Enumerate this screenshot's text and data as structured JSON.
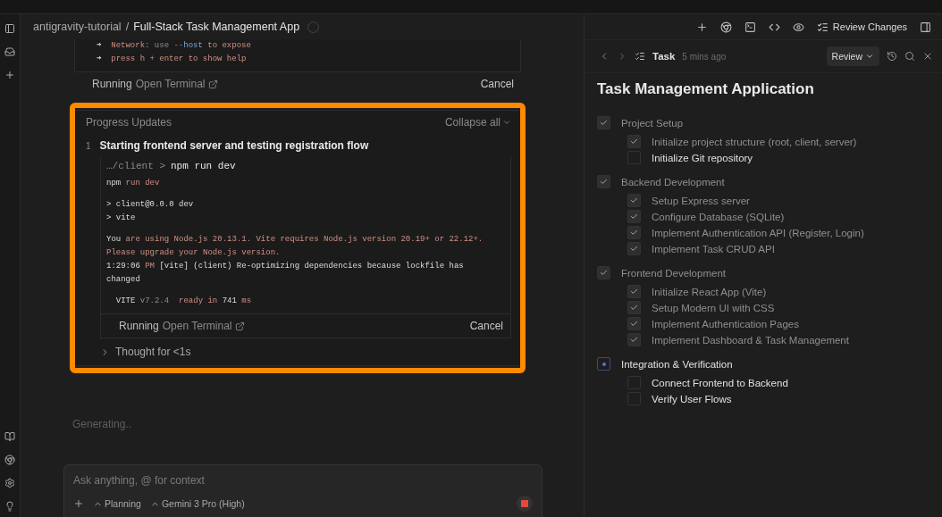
{
  "breadcrumb": {
    "workspace": "antigravity-tutorial",
    "separator": "/",
    "title": "Full-Stack Task Management App"
  },
  "toolbar": {
    "review_changes": "Review Changes"
  },
  "earlier_terminal": {
    "blocks": [
      [
        {
          "segments": [
            {
              "text": "➜  ",
              "kind": "plain"
            },
            {
              "text": "Network: ",
              "kind": "red"
            },
            {
              "text": "use --",
              "kind": "dim"
            },
            {
              "text": "host",
              "kind": "blue"
            },
            {
              "text": " to expose",
              "kind": "red"
            }
          ]
        },
        {
          "segments": [
            {
              "text": "➜  ",
              "kind": "plain"
            },
            {
              "text": "press h + enter to show help",
              "kind": "red"
            }
          ]
        }
      ]
    ],
    "status": "Running",
    "open_terminal": "Open Terminal",
    "cancel": "Cancel"
  },
  "progress": {
    "title": "Progress Updates",
    "collapse": "Collapse all",
    "step_number": "1",
    "step_title": "Starting frontend server and testing registration flow",
    "command_path": "…/client >",
    "command": "npm run dev",
    "blocks": [
      [
        {
          "segments": [
            {
              "text": "npm ",
              "kind": "plain"
            },
            {
              "text": "run dev",
              "kind": "red"
            }
          ]
        }
      ],
      [
        {
          "segments": [
            {
              "text": "> client@0.0.0 dev",
              "kind": "plain"
            }
          ]
        },
        {
          "segments": [
            {
              "text": "> vite",
              "kind": "plain"
            }
          ]
        }
      ],
      [
        {
          "segments": [
            {
              "text": "You ",
              "kind": "plain"
            },
            {
              "text": "are using Node.js 20.13.1. Vite requires Node.js version 20.19+ or 22.12+.",
              "kind": "red"
            }
          ]
        },
        {
          "segments": [
            {
              "text": "Please upgrade your Node.js version.",
              "kind": "red"
            }
          ]
        },
        {
          "segments": [
            {
              "text": "1:29:06 ",
              "kind": "plain"
            },
            {
              "text": "PM ",
              "kind": "red"
            },
            {
              "text": "[vite] (client) Re-optimizing dependencies because lockfile has",
              "kind": "plain"
            }
          ]
        },
        {
          "segments": [
            {
              "text": "changed",
              "kind": "plain"
            }
          ]
        }
      ],
      [
        {
          "segments": [
            {
              "text": "  VITE ",
              "kind": "plain"
            },
            {
              "text": "v7.2.4  ",
              "kind": "dim"
            },
            {
              "text": "ready in ",
              "kind": "red"
            },
            {
              "text": "741 ",
              "kind": "plain"
            },
            {
              "text": "ms",
              "kind": "red"
            }
          ]
        }
      ]
    ],
    "status": "Running",
    "open_terminal": "Open Terminal",
    "cancel": "Cancel",
    "thought": "Thought for <1s"
  },
  "generating": "Generating..",
  "composer": {
    "placeholder": "Ask anything, @ for context",
    "mode": "Planning",
    "model": "Gemini 3 Pro (High)"
  },
  "task_panel": {
    "title": "Task",
    "time": "5 mins ago",
    "review": "Review",
    "heading": "Task Management Application",
    "sections": [
      {
        "label": "Project Setup",
        "kind": "done",
        "children": [
          {
            "label": "Initialize project structure (root, client, server)",
            "checked": true
          },
          {
            "label": "Initialize Git repository",
            "checked": false
          }
        ]
      },
      {
        "label": "Backend Development",
        "kind": "done",
        "children": [
          {
            "label": "Setup Express server",
            "checked": true
          },
          {
            "label": "Configure Database (SQLite)",
            "checked": true
          },
          {
            "label": "Implement Authentication API (Register, Login)",
            "checked": true
          },
          {
            "label": "Implement Task CRUD API",
            "checked": true
          }
        ]
      },
      {
        "label": "Frontend Development",
        "kind": "done",
        "children": [
          {
            "label": "Initialize React App (Vite)",
            "checked": true
          },
          {
            "label": "Setup Modern UI with CSS",
            "checked": true
          },
          {
            "label": "Implement Authentication Pages",
            "checked": true
          },
          {
            "label": "Implement Dashboard & Task Management",
            "checked": true
          }
        ]
      },
      {
        "label": "Integration & Verification",
        "kind": "active",
        "children": [
          {
            "label": "Connect Frontend to Backend",
            "checked": false
          },
          {
            "label": "Verify User Flows",
            "checked": false
          }
        ]
      }
    ]
  }
}
